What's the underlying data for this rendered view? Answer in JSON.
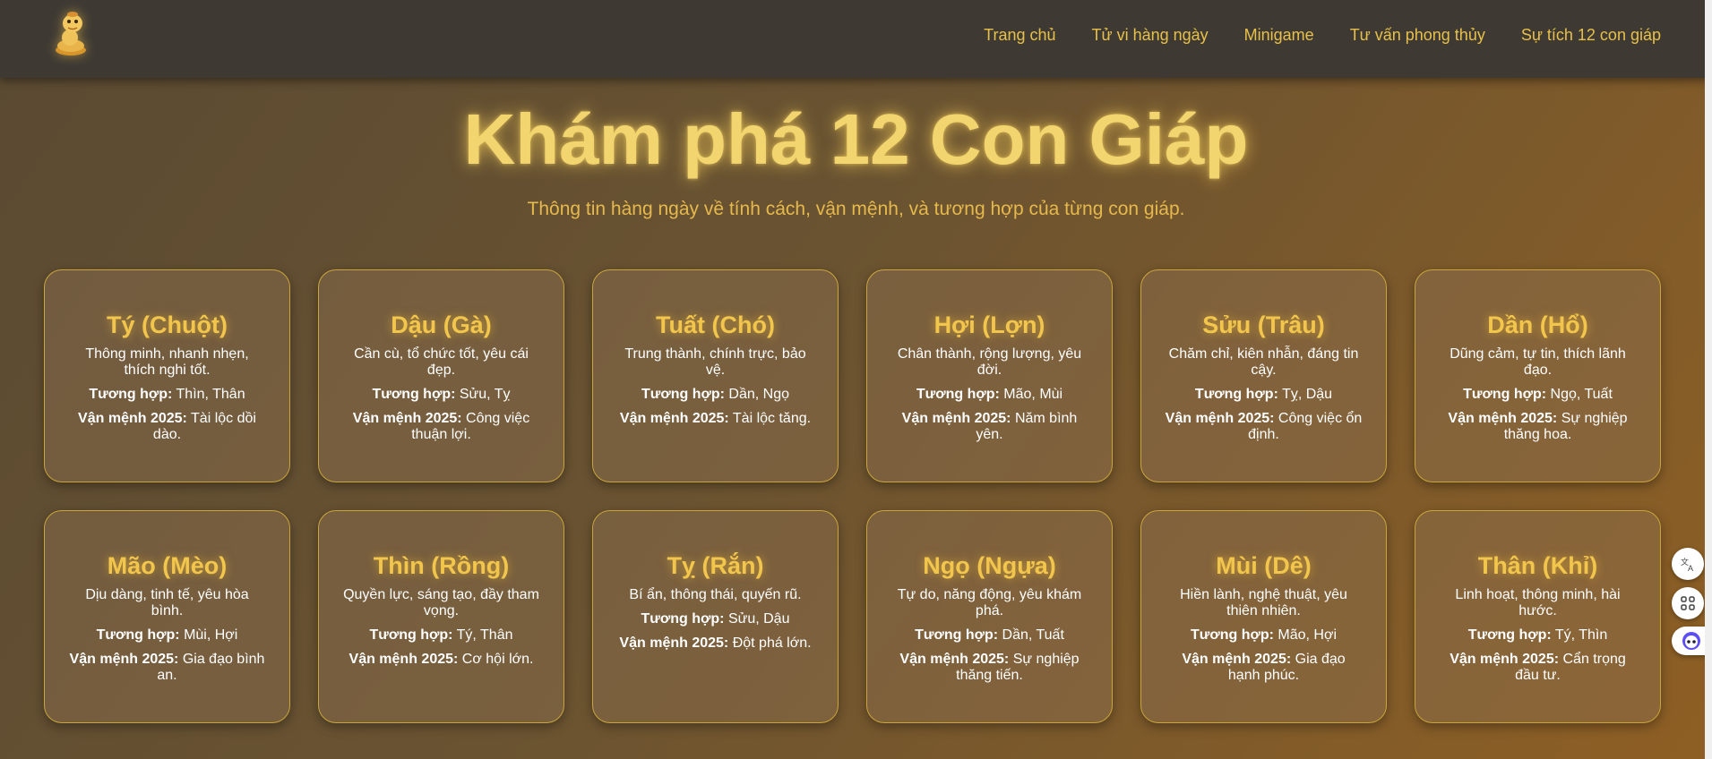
{
  "nav": {
    "logo_alt": "snake-logo",
    "links": [
      "Trang chủ",
      "Tử vi hàng ngày",
      "Minigame",
      "Tư vấn phong thủy",
      "Sự tích 12 con giáp"
    ]
  },
  "hero": {
    "title": "Khám phá 12 Con Giáp",
    "subtitle": "Thông tin hàng ngày về tính cách, vận mệnh, và tương hợp của từng con giáp."
  },
  "labels": {
    "compat": "Tương hợp:",
    "fortune": "Vận mệnh 2025:"
  },
  "cards": [
    {
      "title": "Tý (Chuột)",
      "desc": "Thông minh, nhanh nhẹn, thích nghi tốt.",
      "compat": " Thìn, Thân",
      "fortune": " Tài lộc dồi dào."
    },
    {
      "title": "Dậu (Gà)",
      "desc": "Cần cù, tổ chức tốt, yêu cái đẹp.",
      "compat": " Sửu, Tỵ",
      "fortune": " Công việc thuận lợi."
    },
    {
      "title": "Tuất (Chó)",
      "desc": "Trung thành, chính trực, bảo vệ.",
      "compat": " Dần, Ngọ",
      "fortune": " Tài lộc tăng."
    },
    {
      "title": "Hợi (Lợn)",
      "desc": "Chân thành, rộng lượng, yêu đời.",
      "compat": " Mão, Mùi",
      "fortune": " Năm bình yên."
    },
    {
      "title": "Sửu (Trâu)",
      "desc": "Chăm chỉ, kiên nhẫn, đáng tin cậy.",
      "compat": " Tỵ, Dậu",
      "fortune": " Công việc ổn định."
    },
    {
      "title": "Dần (Hổ)",
      "desc": "Dũng cảm, tự tin, thích lãnh đạo.",
      "compat": " Ngọ, Tuất",
      "fortune": " Sự nghiệp thăng hoa."
    },
    {
      "title": "Mão (Mèo)",
      "desc": "Dịu dàng, tinh tế, yêu hòa bình.",
      "compat": " Mùi, Hợi",
      "fortune": " Gia đạo bình an."
    },
    {
      "title": "Thìn (Rồng)",
      "desc": "Quyền lực, sáng tạo, đầy tham vọng.",
      "compat": " Tý, Thân",
      "fortune": " Cơ hội lớn."
    },
    {
      "title": "Tỵ (Rắn)",
      "desc": "Bí ẩn, thông thái, quyến rũ.",
      "compat": " Sửu, Dậu",
      "fortune": " Đột phá lớn."
    },
    {
      "title": "Ngọ (Ngựa)",
      "desc": "Tự do, năng động, yêu khám phá.",
      "compat": " Dần, Tuất",
      "fortune": " Sự nghiệp thăng tiến."
    },
    {
      "title": "Mùi (Dê)",
      "desc": "Hiền lành, nghệ thuật, yêu thiên nhiên.",
      "compat": " Mão, Hợi",
      "fortune": " Gia đạo hạnh phúc."
    },
    {
      "title": "Thân (Khỉ)",
      "desc": "Linh hoạt, thông minh, hài hước.",
      "compat": " Tý, Thìn",
      "fortune": " Cẩn trọng đầu tư."
    }
  ],
  "side_tools": [
    "translate-icon",
    "apps-icon",
    "assistant-icon"
  ],
  "colors": {
    "accent": "#e7c04a",
    "title": "#f3d56f",
    "nav_bg": "#3e3a33",
    "card_border": "#c9a53c"
  }
}
